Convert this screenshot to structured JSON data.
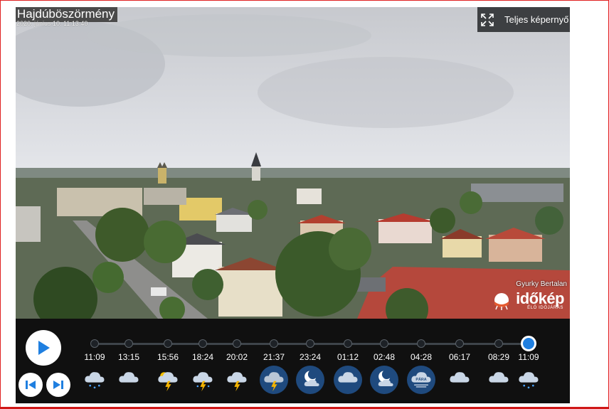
{
  "camera": {
    "location": "Hajdúböszörmény",
    "timestamp": "2020. június 10. 11:13:40",
    "fullscreen_label": "Teljes képernyő",
    "credit": "Gyurky Bertalan",
    "logo_text": "időkép",
    "logo_tagline": "ÉLŐ IDŐJÁRÁS"
  },
  "player": {
    "active_index": 12,
    "frames": [
      {
        "time": "11:09",
        "icon": "rain-cloud-icon",
        "night": false
      },
      {
        "time": "13:15",
        "icon": "cloud-icon",
        "night": false
      },
      {
        "time": "15:56",
        "icon": "sun-cloud-storm-icon",
        "night": false
      },
      {
        "time": "18:24",
        "icon": "thunderstorm-rain-icon",
        "night": false
      },
      {
        "time": "20:02",
        "icon": "thunderstorm-icon",
        "night": false
      },
      {
        "time": "21:37",
        "icon": "thunderstorm-night-icon",
        "night": true
      },
      {
        "time": "23:24",
        "icon": "moon-cloud-icon",
        "night": true
      },
      {
        "time": "01:12",
        "icon": "cloud-night-icon",
        "night": true
      },
      {
        "time": "02:48",
        "icon": "moon-cloud-icon",
        "night": true
      },
      {
        "time": "04:28",
        "icon": "mist-icon",
        "night": true,
        "label": "PÁRA"
      },
      {
        "time": "06:17",
        "icon": "cloud-icon",
        "night": false
      },
      {
        "time": "08:29",
        "icon": "cloud-icon",
        "night": false
      },
      {
        "time": "11:09",
        "icon": "rain-cloud-icon",
        "night": false
      }
    ]
  }
}
